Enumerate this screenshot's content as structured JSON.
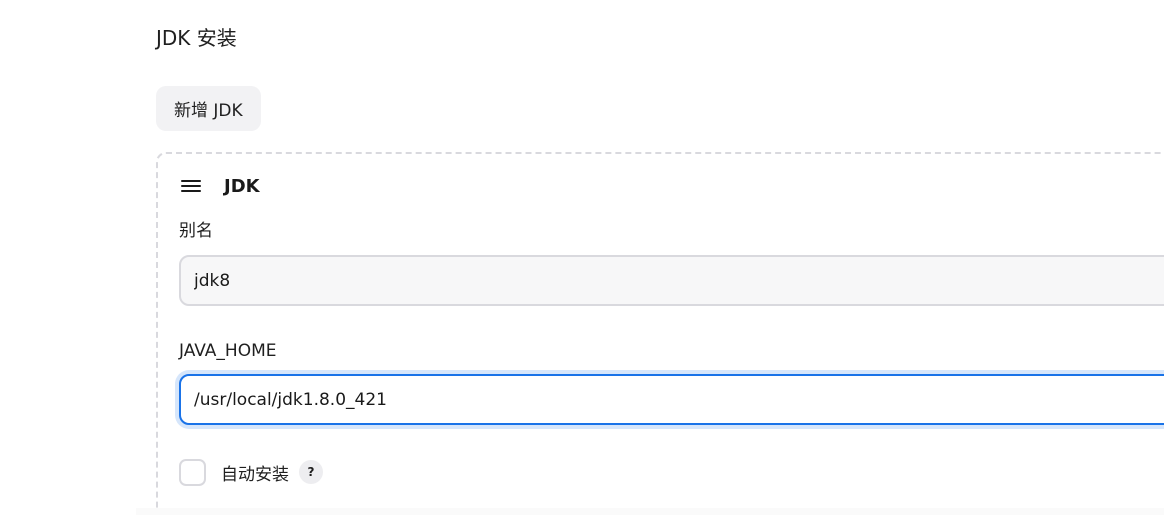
{
  "section": {
    "title": "JDK 安装",
    "add_button_label": "新增 JDK"
  },
  "jdk_entry": {
    "title": "JDK",
    "drag_handle_icon": "menu-lines-icon",
    "alias": {
      "label": "别名",
      "value": "jdk8"
    },
    "java_home": {
      "label": "JAVA_HOME",
      "value": "/usr/local/jdk1.8.0_421"
    },
    "auto_install": {
      "label": "自动安装",
      "checked": false,
      "help_icon_label": "?"
    }
  },
  "colors": {
    "focus_border": "#1a73e8",
    "input_border": "#d9d9de",
    "button_bg": "#f2f2f4"
  }
}
